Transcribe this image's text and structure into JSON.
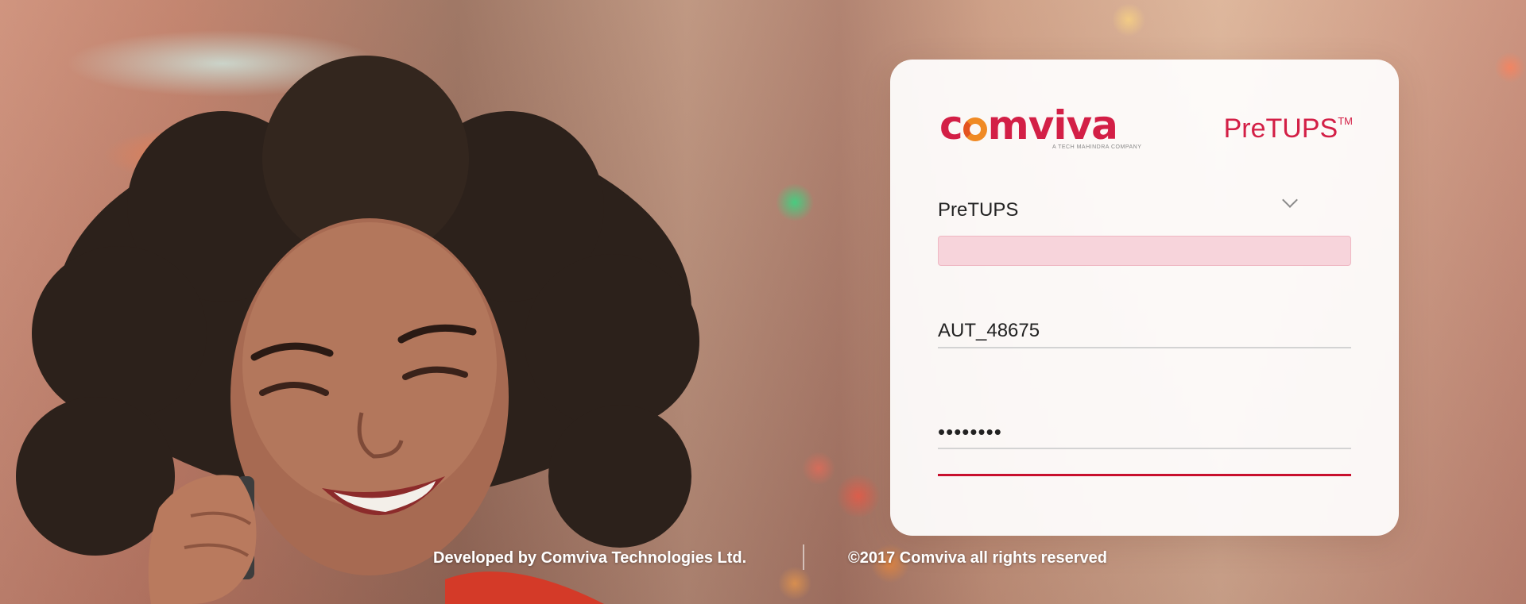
{
  "brand": {
    "name": "comviva",
    "tagline": "A TECH MAHINDRA COMPANY",
    "product": "PreTUPS",
    "product_mark": "TM",
    "color": "#d31f46"
  },
  "form": {
    "network_select": {
      "value": "PreTUPS"
    },
    "login_id": {
      "value": "AUT_48675"
    },
    "password": {
      "value": "••••••••"
    },
    "error_bar_color": "#f7d4db",
    "accent_color": "#c8102e"
  },
  "footer": {
    "developer": "Developed by Comviva Technologies Ltd.",
    "copyright": "©2017 Comviva all rights reserved"
  }
}
